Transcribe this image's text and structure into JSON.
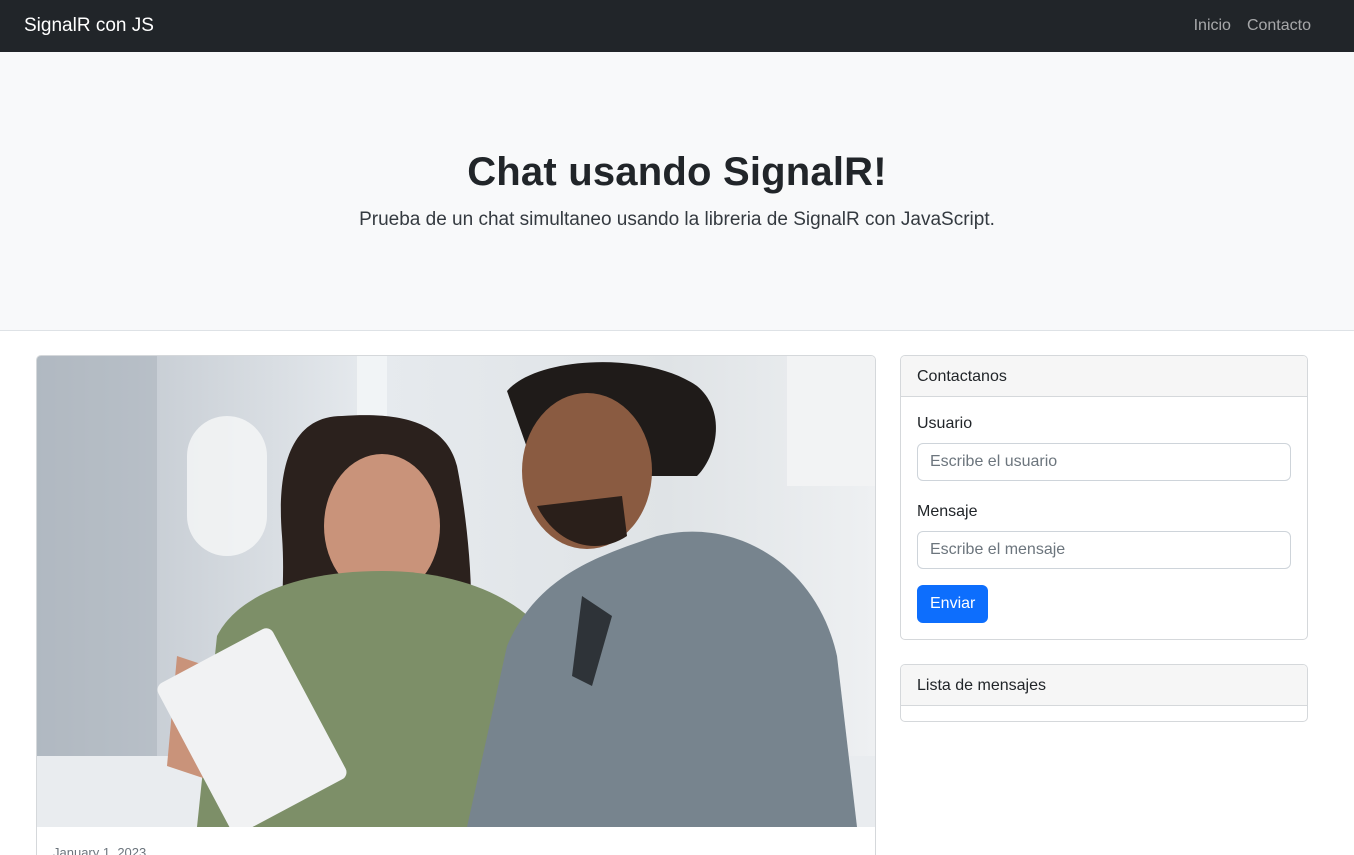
{
  "navbar": {
    "brand": "SignalR con JS",
    "links": [
      "Inicio",
      "Contacto"
    ]
  },
  "hero": {
    "title": "Chat usando SignalR!",
    "subtitle": "Prueba de un chat simultaneo usando la libreria de SignalR con JavaScript."
  },
  "post": {
    "date": "January 1, 2023"
  },
  "contact": {
    "header": "Contactanos",
    "user_label": "Usuario",
    "user_placeholder": "Escribe el usuario",
    "message_label": "Mensaje",
    "message_placeholder": "Escribe el mensaje",
    "send_label": "Enviar"
  },
  "messages": {
    "header": "Lista de mensajes"
  },
  "colors": {
    "navbar": "#212529",
    "primary": "#0d6efd",
    "hero_bg": "#f8f9fa"
  }
}
